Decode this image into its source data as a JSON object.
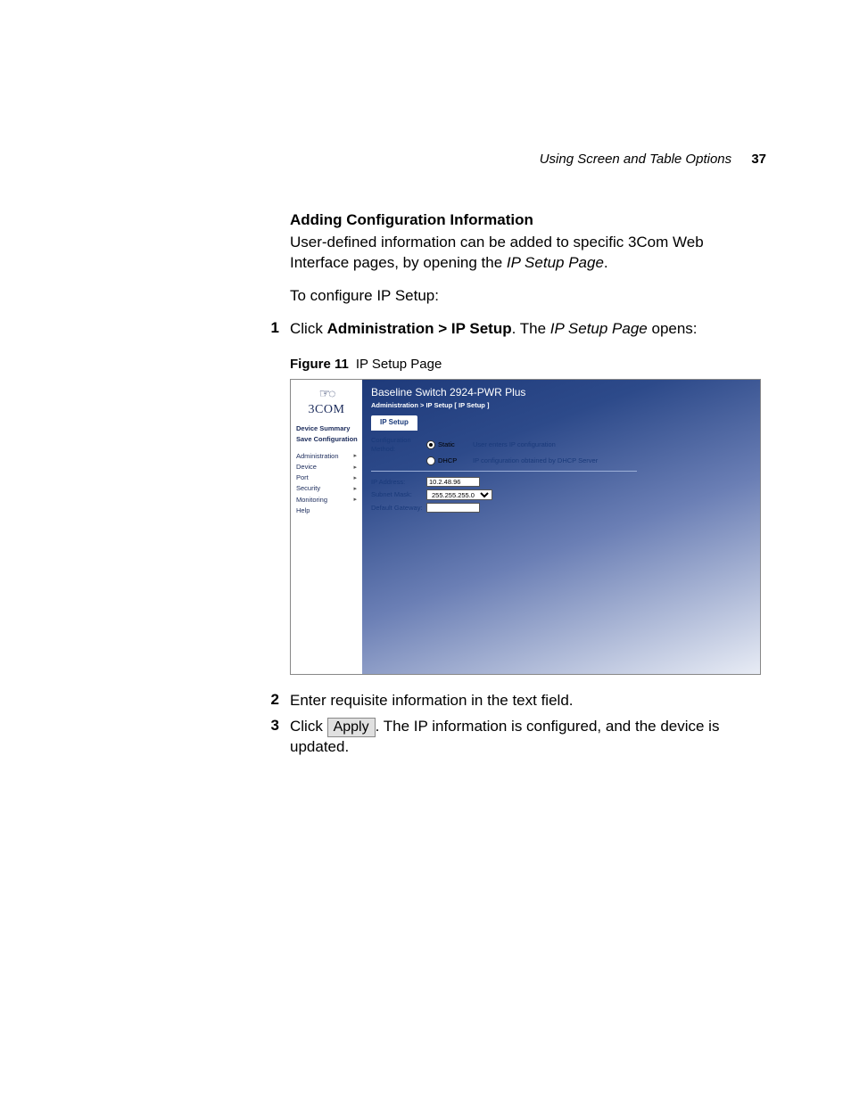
{
  "header": {
    "running_title": "Using Screen and Table Options",
    "page_number": "37"
  },
  "section": {
    "heading": "Adding Configuration Information",
    "p1_a": "User-defined information can be added to specific 3Com Web Interface pages, by opening the ",
    "p1_italic": "IP Setup Page",
    "p1_b": ".",
    "p2": "To configure IP Setup:"
  },
  "steps": {
    "s1_num": "1",
    "s1_a": "Click ",
    "s1_bold": "Administration > IP Setup",
    "s1_b": ". The ",
    "s1_italic": "IP Setup Page",
    "s1_c": " opens:",
    "s2_num": "2",
    "s2_text": "Enter requisite information in the text field.",
    "s3_num": "3",
    "s3_a": "Click ",
    "s3_btn": "Apply",
    "s3_b": ". The IP information is configured, and the device is updated."
  },
  "figure": {
    "label": "Figure 11",
    "caption": "IP Setup Page"
  },
  "screenshot": {
    "brand": "3COM",
    "sidebar": {
      "device_summary": "Device Summary",
      "save_config": "Save Configuration",
      "nav": {
        "administration": "Administration",
        "device": "Device",
        "port": "Port",
        "security": "Security",
        "monitoring": "Monitoring",
        "help": "Help"
      }
    },
    "title": "Baseline Switch 2924-PWR Plus",
    "breadcrumb": "Administration > IP Setup [ IP Setup ]",
    "tab": "IP Setup",
    "form": {
      "config_method_label": "Configuration Method:",
      "static_label": "Static",
      "static_desc": "User enters IP configuration",
      "dhcp_label": "DHCP",
      "dhcp_desc": "IP configuration obtained by DHCP Server",
      "ip_address_label": "IP Address:",
      "ip_address_value": "10.2.48.96",
      "subnet_label": "Subnet Mask:",
      "subnet_value": "255.255.255.0",
      "gateway_label": "Default Gateway:",
      "gateway_value": ""
    }
  }
}
